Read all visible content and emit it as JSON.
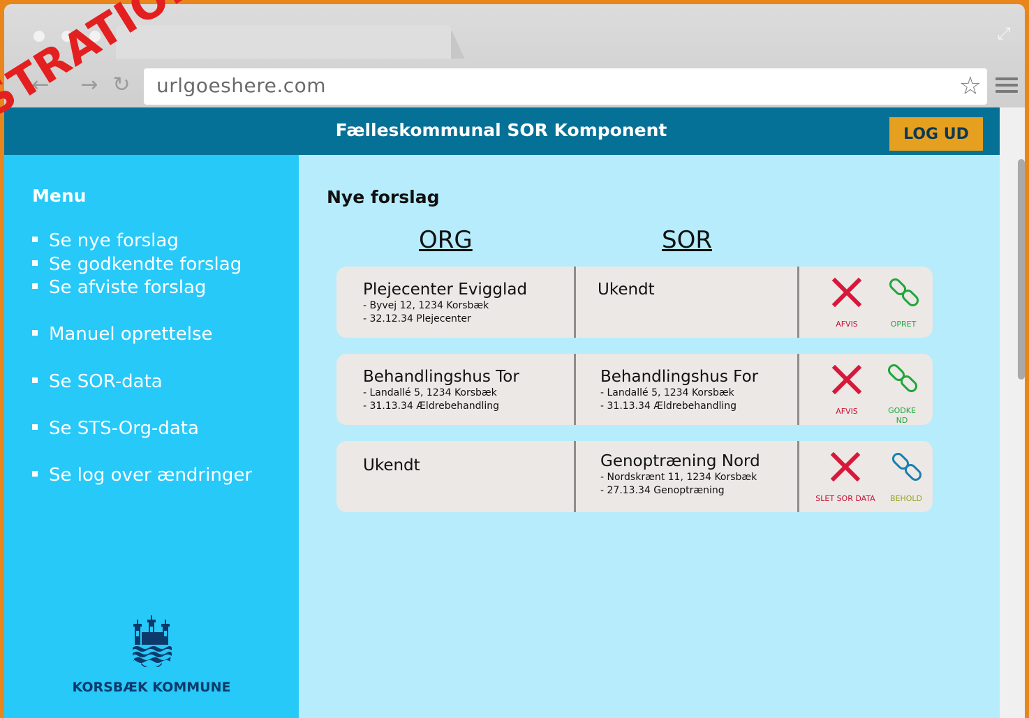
{
  "browser": {
    "url": "urlgoeshere.com"
  },
  "header": {
    "title": "Fælleskommunal SOR Komponent",
    "logout_label": "LOG UD"
  },
  "sidebar": {
    "title": "Menu",
    "items": [
      {
        "label": "Se nye forslag"
      },
      {
        "label": "Se godkendte forslag"
      },
      {
        "label": "Se afviste forslag"
      },
      {
        "label": "Manuel oprettelse"
      },
      {
        "label": "Se SOR-data"
      },
      {
        "label": "Se STS-Org-data"
      },
      {
        "label": "Se log over ændringer"
      }
    ],
    "logo_name": "KORSBÆK KOMMUNE"
  },
  "main": {
    "title": "Nye forslag",
    "columns": {
      "org": "ORG",
      "sor": "SOR"
    },
    "rows": [
      {
        "org": {
          "name": "Plejecenter Evigglad",
          "line1": "- Byvej 12, 1234 Korsbæk",
          "line2": "- 32.12.34 Plejecenter"
        },
        "sor": {
          "name": "Ukendt",
          "line1": "",
          "line2": ""
        },
        "action_reject": "AFVIS",
        "action_accept": "OPRET"
      },
      {
        "org": {
          "name": "Behandlingshus Tor",
          "line1": "- Landallé 5, 1234 Korsbæk",
          "line2": "- 31.13.34 Ældrebehandling"
        },
        "sor": {
          "name": "Behandlingshus For",
          "line1": "- Landallé 5, 1234 Korsbæk",
          "line2": "- 31.13.34 Ældrebehandling"
        },
        "action_reject": "AFVIS",
        "action_accept": "GODKEND"
      },
      {
        "org": {
          "name": "Ukendt",
          "line1": "",
          "line2": ""
        },
        "sor": {
          "name": "Genoptræning Nord",
          "line1": "- Nordskrænt 11, 1234 Korsbæk",
          "line2": "- 27.13.34 Genoptræning"
        },
        "action_reject": "SLET SOR DATA",
        "action_accept": "BEHOLD"
      }
    ]
  },
  "watermark": "STRATION",
  "colors": {
    "header_bg": "#057197",
    "sidebar_bg": "#27c9f9",
    "main_bg": "#b6ecfb",
    "logout_bg": "#e6a020",
    "reject": "#d8183a",
    "accept_green": "#1fa63a",
    "accept_blue": "#1a7fb0",
    "behold_label": "#9aa31c"
  },
  "icons": [
    "back-arrow-icon",
    "forward-arrow-icon",
    "reload-icon",
    "star-icon",
    "hamburger-menu-icon",
    "expand-icon",
    "reject-x-icon",
    "link-chain-icon",
    "korsbaek-crest-icon"
  ]
}
